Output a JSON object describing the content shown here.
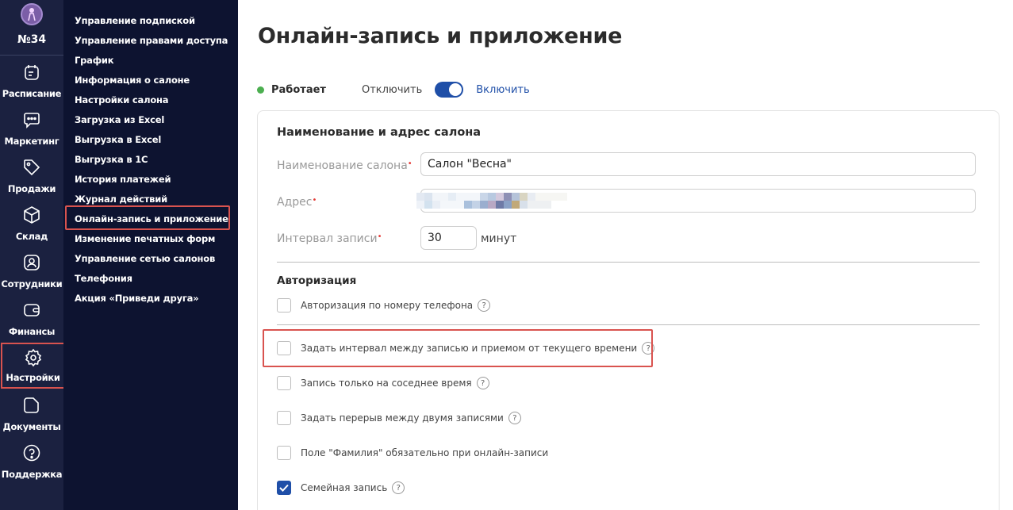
{
  "rail": {
    "salon_number": "№34",
    "items": [
      {
        "label": "Расписание",
        "icon": "calendar-icon"
      },
      {
        "label": "Маркетинг",
        "icon": "chat-icon"
      },
      {
        "label": "Продажи",
        "icon": "tag-icon"
      },
      {
        "label": "Склад",
        "icon": "box-icon"
      },
      {
        "label": "Сотрудники",
        "icon": "user-icon"
      },
      {
        "label": "Финансы",
        "icon": "wallet-icon"
      },
      {
        "label": "Настройки",
        "icon": "gear-icon"
      },
      {
        "label": "Документы",
        "icon": "document-icon"
      },
      {
        "label": "Поддержка",
        "icon": "help-icon"
      }
    ]
  },
  "submenu": {
    "items": [
      "Управление подпиской",
      "Управление правами доступа",
      "График",
      "Информация о салоне",
      "Настройки салона",
      "Загрузка из Excel",
      "Выгрузка в Excel",
      "Выгрузка в 1С",
      "История платежей",
      "Журнал действий",
      "Онлайн-запись и приложение",
      "Изменение печатных форм",
      "Управление сетью салонов",
      "Телефония",
      "Акция «Приведи друга»"
    ]
  },
  "main": {
    "title": "Онлайн-запись и приложение",
    "status": "Работает",
    "status_color": "#4caf50",
    "toggle_off_label": "Отключить",
    "toggle_on_label": "Включить",
    "section_name_title": "Наименование и адрес салона",
    "salon_name_label": "Наименование салона",
    "salon_name_value": "Салон \"Весна\"",
    "address_label": "Адрес",
    "interval_label": "Интервал записи",
    "interval_value": "30",
    "interval_unit": "минут",
    "auth_title": "Авторизация",
    "checkboxes": {
      "phone_auth": "Авторизация по номеру телефона",
      "set_interval": "Задать интервал между записью и приемом от текущего времени",
      "adjacent_time": "Запись только на соседнее время",
      "break_between": "Задать перерыв между двумя записями",
      "lastname_required": "Поле \"Фамилия\" обязательно при онлайн-записи",
      "family_booking": "Семейная запись"
    },
    "help_glyph": "?"
  },
  "colors": {
    "rail_bg": "#1b2140",
    "submenu_bg": "#0d1330",
    "accent": "#1f4fa8",
    "highlight": "#d9534f"
  }
}
